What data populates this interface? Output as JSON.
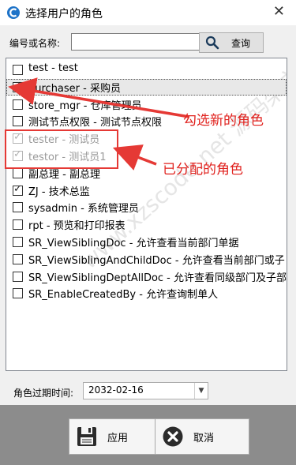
{
  "window": {
    "title": "选择用户的角色",
    "close_glyph": "✕"
  },
  "search": {
    "label": "编号或名称:",
    "value": "",
    "placeholder": "",
    "button_label": "查询"
  },
  "roles": [
    {
      "label": "test - test",
      "checked": false,
      "disabled": false
    },
    {
      "label": "purchaser - 采购员",
      "checked": true,
      "disabled": false,
      "selected": true
    },
    {
      "label": "store_mgr - 仓库管理员",
      "checked": false,
      "disabled": false
    },
    {
      "label": "测试节点权限 - 测试节点权限",
      "checked": false,
      "disabled": false
    },
    {
      "label": "tester - 测试员",
      "checked": true,
      "disabled": true
    },
    {
      "label": "testor - 测试员1",
      "checked": true,
      "disabled": true
    },
    {
      "label": "副总理 - 副总理",
      "checked": false,
      "disabled": false
    },
    {
      "label": "ZJ - 技术总监",
      "checked": true,
      "disabled": false
    },
    {
      "label": "sysadmin - 系统管理员",
      "checked": false,
      "disabled": false
    },
    {
      "label": "rpt - 预览和打印报表",
      "checked": false,
      "disabled": false
    },
    {
      "label": "SR_ViewSiblingDoc - 允许查看当前部门单据",
      "checked": false,
      "disabled": false
    },
    {
      "label": "SR_ViewSiblingAndChildDoc - 允许查看当前部门或子",
      "checked": false,
      "disabled": false
    },
    {
      "label": "SR_ViewSiblingDeptAllDoc - 允许查看同级部门及子部",
      "checked": false,
      "disabled": false
    },
    {
      "label": "SR_EnableCreatedBy - 允许查询制单人",
      "checked": false,
      "disabled": false
    }
  ],
  "watermark": "www.xzscode.net 源码架文库",
  "annotations": {
    "new_role": "勾选新的角色",
    "assigned_roles": "已分配的角色",
    "color": "#e53935"
  },
  "expiry": {
    "label": "角色过期时间:",
    "value": "2032-02-16"
  },
  "footer": {
    "apply_label": "应用",
    "cancel_label": "取消"
  },
  "icons": {
    "app": "app-logo-icon",
    "search": "magnifier-icon",
    "apply": "floppy-disk-icon",
    "cancel": "close-circle-icon"
  }
}
